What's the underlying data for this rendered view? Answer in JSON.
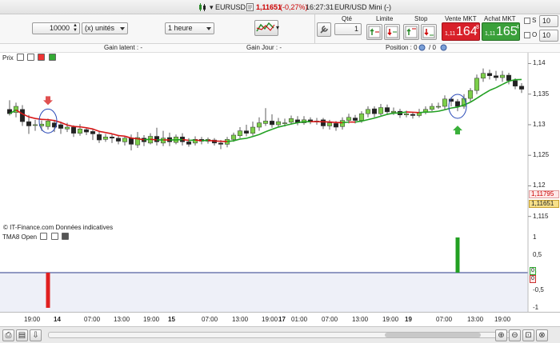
{
  "title": {
    "symbol": "EURUSD",
    "price": "1,11651",
    "change": "(-0,27%)",
    "time": "16:27:31",
    "instrument": "EUR/USD Mini (-)"
  },
  "toolbar": {
    "quantity_value": "10000",
    "unit_label": "(x) unités",
    "timeframe_label": "1 heure",
    "qty_header": "Qté",
    "qty_value": "1",
    "limit_header": "Limite",
    "stop_header": "Stop",
    "sell_header": "Vente MKT",
    "sell_prefix": "1,11",
    "sell_big": "164",
    "sell_sup": "8",
    "buy_header": "Achat MKT",
    "buy_prefix": "1,11",
    "buy_big": "165",
    "buy_sup": "4",
    "s_label": "S",
    "o_label": "O",
    "s_value": "10",
    "o_value": "10"
  },
  "infobar": {
    "latent": "Gain latent : -",
    "jour": "Gain Jour : -",
    "position": "Position : 0",
    "position_tail": "/ 0"
  },
  "price_panel": {
    "title": "Prix",
    "credit": "© IT-Finance.com  Données indicatives",
    "y_ticks": [
      "1,14",
      "1,135",
      "1,13",
      "1,125",
      "1,12",
      "1,115"
    ],
    "label_red": "1,11795",
    "label_current": "1,11651"
  },
  "indicator_panel": {
    "title": "TMA8 Open",
    "y_ticks": [
      "1",
      "0,5",
      "0",
      "-0,5",
      "-1"
    ],
    "label_a": "0",
    "label_b": "0"
  },
  "x_axis": {
    "labels": [
      "19:00",
      "14",
      "07:00",
      "13:00",
      "19:00",
      "15",
      "07:00",
      "13:00",
      "19:00",
      "17",
      "01:00",
      "07:00",
      "13:00",
      "19:00",
      "19",
      "07:00",
      "13:00",
      "19:00"
    ]
  },
  "chart_data": {
    "type": "candlestick",
    "title": "Prix",
    "ylim": [
      1.113,
      1.1415
    ],
    "candles": [
      [
        1.1325,
        1.1318,
        1.134,
        1.1315
      ],
      [
        1.132,
        1.133,
        1.1336,
        1.1312
      ],
      [
        1.1325,
        1.1305,
        1.1332,
        1.1298
      ],
      [
        1.1305,
        1.1298,
        1.1316,
        1.1285
      ],
      [
        1.13,
        1.13,
        1.1308,
        1.129
      ],
      [
        1.1298,
        1.1301,
        1.1307,
        1.129
      ],
      [
        1.1297,
        1.1306,
        1.131,
        1.1292
      ],
      [
        1.1303,
        1.1296,
        1.1308,
        1.1288
      ],
      [
        1.13,
        1.1294,
        1.1305,
        1.1285
      ],
      [
        1.1293,
        1.1296,
        1.1303,
        1.1288
      ],
      [
        1.1296,
        1.1286,
        1.1299,
        1.128
      ],
      [
        1.1286,
        1.1293,
        1.1301,
        1.1282
      ],
      [
        1.1292,
        1.1288,
        1.1296,
        1.1283
      ],
      [
        1.1289,
        1.1285,
        1.1294,
        1.1275
      ],
      [
        1.1284,
        1.1275,
        1.129,
        1.127
      ],
      [
        1.1276,
        1.128,
        1.1285,
        1.1272
      ],
      [
        1.128,
        1.1278,
        1.1285,
        1.127
      ],
      [
        1.1278,
        1.1273,
        1.1283,
        1.1268
      ],
      [
        1.1272,
        1.1278,
        1.1282,
        1.1266
      ],
      [
        1.1278,
        1.1268,
        1.1284,
        1.1258
      ],
      [
        1.1267,
        1.1279,
        1.1288,
        1.1262
      ],
      [
        1.1278,
        1.1272,
        1.1283,
        1.1265
      ],
      [
        1.127,
        1.1281,
        1.1286,
        1.1268
      ],
      [
        1.1281,
        1.1272,
        1.1295,
        1.1266
      ],
      [
        1.127,
        1.1278,
        1.129,
        1.1265
      ],
      [
        1.1279,
        1.1272,
        1.1287,
        1.1265
      ],
      [
        1.1271,
        1.128,
        1.1284,
        1.1268
      ],
      [
        1.128,
        1.1272,
        1.1286,
        1.1266
      ],
      [
        1.1272,
        1.1268,
        1.1278,
        1.1264
      ],
      [
        1.127,
        1.1276,
        1.1281,
        1.1266
      ],
      [
        1.1276,
        1.1273,
        1.128,
        1.1268
      ],
      [
        1.1273,
        1.1276,
        1.1279,
        1.1269
      ],
      [
        1.1275,
        1.127,
        1.1278,
        1.1266
      ],
      [
        1.127,
        1.1268,
        1.1275,
        1.126
      ],
      [
        1.1268,
        1.1276,
        1.128,
        1.1263
      ],
      [
        1.1276,
        1.1283,
        1.1287,
        1.1272
      ],
      [
        1.1282,
        1.129,
        1.1296,
        1.1278
      ],
      [
        1.129,
        1.1286,
        1.13,
        1.1281
      ],
      [
        1.1286,
        1.1296,
        1.1305,
        1.1282
      ],
      [
        1.1296,
        1.1303,
        1.1312,
        1.129
      ],
      [
        1.1302,
        1.1306,
        1.1327,
        1.1298
      ],
      [
        1.1306,
        1.13,
        1.1317,
        1.1295
      ],
      [
        1.13,
        1.1305,
        1.1311,
        1.1296
      ],
      [
        1.1303,
        1.1303,
        1.131,
        1.1297
      ],
      [
        1.1304,
        1.131,
        1.1315,
        1.13
      ],
      [
        1.1308,
        1.1303,
        1.1314,
        1.1299
      ],
      [
        1.1303,
        1.1308,
        1.1314,
        1.13
      ],
      [
        1.1308,
        1.1305,
        1.1312,
        1.1301
      ],
      [
        1.1305,
        1.1306,
        1.1311,
        1.13
      ],
      [
        1.1308,
        1.1298,
        1.1311,
        1.1293
      ],
      [
        1.1298,
        1.1303,
        1.1308,
        1.1292
      ],
      [
        1.1302,
        1.1296,
        1.1306,
        1.129
      ],
      [
        1.1297,
        1.1307,
        1.1312,
        1.1292
      ],
      [
        1.1307,
        1.1312,
        1.1318,
        1.1302
      ],
      [
        1.1311,
        1.1307,
        1.1316,
        1.1302
      ],
      [
        1.1307,
        1.1318,
        1.1322,
        1.1303
      ],
      [
        1.1318,
        1.1325,
        1.133,
        1.1312
      ],
      [
        1.1326,
        1.1318,
        1.133,
        1.1312
      ],
      [
        1.1318,
        1.1328,
        1.1334,
        1.1315
      ],
      [
        1.1328,
        1.1321,
        1.1333,
        1.1316
      ],
      [
        1.132,
        1.1322,
        1.1328,
        1.1316
      ],
      [
        1.1322,
        1.1316,
        1.1326,
        1.1311
      ],
      [
        1.1316,
        1.1318,
        1.1323,
        1.1312
      ],
      [
        1.1317,
        1.1315,
        1.1321,
        1.131
      ],
      [
        1.1315,
        1.132,
        1.1326,
        1.1312
      ],
      [
        1.132,
        1.1325,
        1.133,
        1.1317
      ],
      [
        1.1325,
        1.133,
        1.1335,
        1.1322
      ],
      [
        1.133,
        1.133,
        1.1336,
        1.1326
      ],
      [
        1.133,
        1.1342,
        1.1348,
        1.1325
      ],
      [
        1.1342,
        1.1338,
        1.1345,
        1.133
      ],
      [
        1.1338,
        1.133,
        1.1342,
        1.1322
      ],
      [
        1.133,
        1.1343,
        1.135,
        1.1326
      ],
      [
        1.1343,
        1.1356,
        1.136,
        1.1338
      ],
      [
        1.1356,
        1.1376,
        1.1382,
        1.135
      ],
      [
        1.1376,
        1.1384,
        1.1392,
        1.137
      ],
      [
        1.1384,
        1.138,
        1.139,
        1.1374
      ],
      [
        1.138,
        1.1377,
        1.1388,
        1.1372
      ],
      [
        1.1377,
        1.1381,
        1.1388,
        1.137
      ],
      [
        1.1381,
        1.1372,
        1.1385,
        1.1366
      ],
      [
        1.1372,
        1.1363,
        1.1376,
        1.1358
      ],
      [
        1.1363,
        1.1358,
        1.1368,
        1.1352
      ]
    ],
    "tma_indicator": [
      -1,
      1
    ]
  }
}
